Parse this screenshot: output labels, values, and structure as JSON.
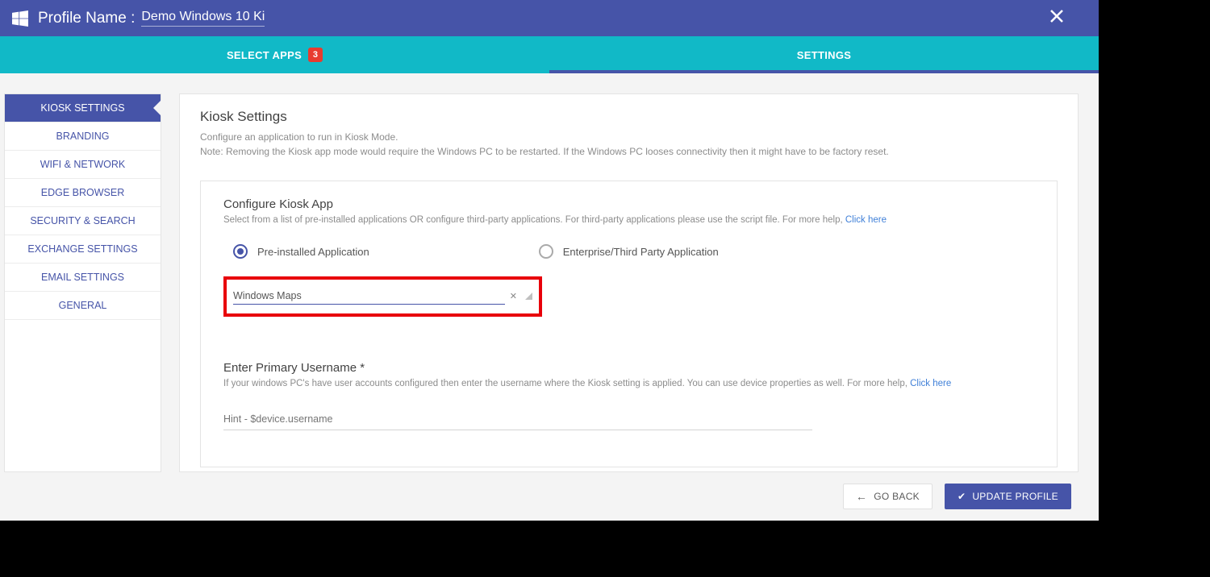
{
  "header": {
    "profile_label": "Profile Name :",
    "profile_name": "Demo Windows 10 Ki"
  },
  "tabs": {
    "select_apps": "SELECT APPS",
    "select_apps_badge": "3",
    "settings": "SETTINGS"
  },
  "sidebar": {
    "items": [
      {
        "label": "KIOSK SETTINGS"
      },
      {
        "label": "BRANDING"
      },
      {
        "label": "WIFI & NETWORK"
      },
      {
        "label": "EDGE BROWSER"
      },
      {
        "label": "SECURITY & SEARCH"
      },
      {
        "label": "EXCHANGE SETTINGS"
      },
      {
        "label": "EMAIL SETTINGS"
      },
      {
        "label": "GENERAL"
      }
    ]
  },
  "main": {
    "title": "Kiosk Settings",
    "desc1": "Configure an application to run in Kiosk Mode.",
    "desc2": "Note: Removing the Kiosk app mode would require the Windows PC to be restarted. If the Windows PC looses connectivity then it might have to be factory reset.",
    "config": {
      "title": "Configure Kiosk App",
      "desc": "Select from a list of pre-installed applications OR configure third-party applications. For third-party applications please use the script file. For more help, ",
      "link": "Click here",
      "radio1": "Pre-installed Application",
      "radio2": "Enterprise/Third Party Application",
      "select_value": "Windows Maps"
    },
    "username": {
      "title": "Enter Primary Username *",
      "desc": "If your windows PC's have user accounts configured then enter the username where the Kiosk setting is applied. You can use device properties as well. For more help, ",
      "link": "Click here",
      "placeholder": "Hint - $device.username"
    }
  },
  "footer": {
    "go_back": "GO BACK",
    "update": "UPDATE PROFILE"
  }
}
